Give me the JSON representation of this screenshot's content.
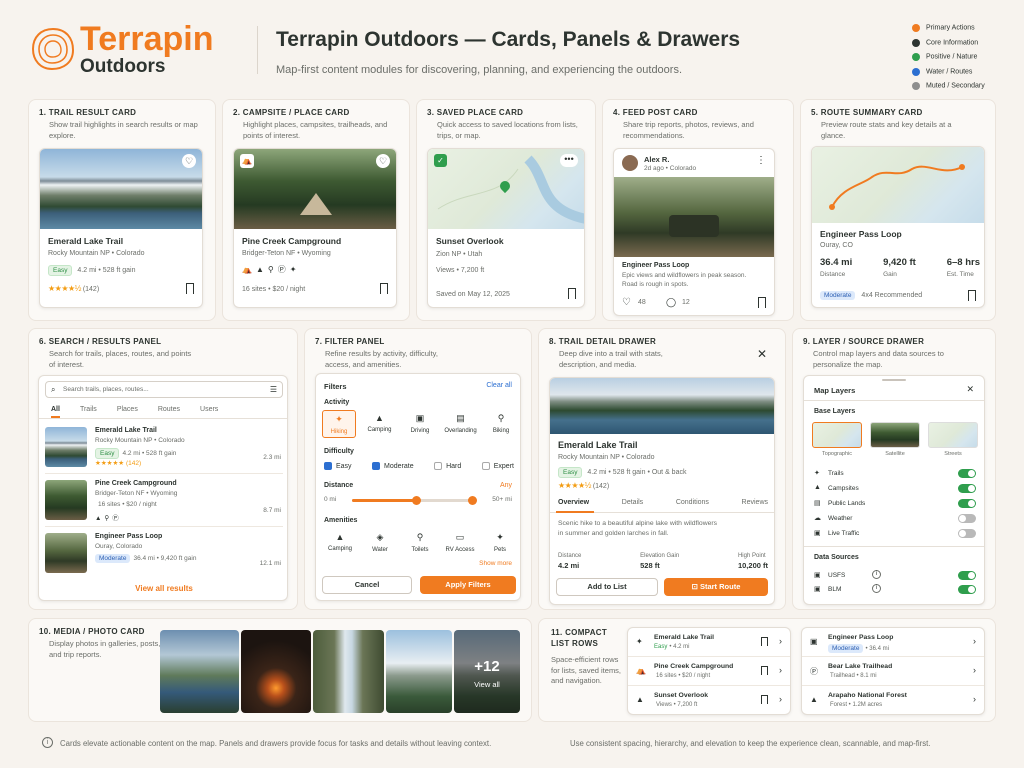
{
  "brand": {
    "name_top": "Terrapin",
    "name_bottom": "Outdoors",
    "title": "Terrapin Outdoors — Cards, Panels & Drawers",
    "subtitle": "Map-first content modules for discovering, planning, and experiencing the outdoors."
  },
  "legend": [
    {
      "label": "Primary Actions",
      "color": "#f07b20"
    },
    {
      "label": "Core Information",
      "color": "#2d3430"
    },
    {
      "label": "Positive / Nature",
      "color": "#2f9e4d"
    },
    {
      "label": "Water / Routes",
      "color": "#2c6fd1"
    },
    {
      "label": "Muted / Secondary",
      "color": "#8e8e8e"
    }
  ],
  "s1": {
    "title": "1. TRAIL RESULT CARD",
    "desc": "Show trail highlights in search results or map explore.",
    "name": "Emerald Lake Trail",
    "loc": "Rocky Mountain NP • Colorado",
    "tag": "Easy",
    "stats": "4.2 mi • 528 ft gain",
    "stars": "★★★★½",
    "reviews": "(142)"
  },
  "s2": {
    "title": "2. CAMPSITE / PLACE CARD",
    "desc": "Highlight places, campsites, trailheads, and points of interest.",
    "name": "Pine Creek Campground",
    "loc": "Bridger-Teton NF • Wyoming",
    "meta": "16 sites • $20 / night"
  },
  "s3": {
    "title": "3. SAVED PLACE CARD",
    "desc": "Quick access to saved locations from lists, trips, or map.",
    "name": "Sunset Overlook",
    "loc": "Zion NP • Utah",
    "views": "Views • 7,200 ft",
    "saved": "Saved on May 12, 2025"
  },
  "s4": {
    "title": "4. FEED POST CARD",
    "desc": "Share trip reports, photos, reviews, and recommendations.",
    "user": "Alex R.",
    "time": "2d ago • Colorado",
    "post_title": "Engineer Pass Loop",
    "post_body": "Epic views and wildflowers in peak season. Road is rough in spots.",
    "likes": "48",
    "comments": "12"
  },
  "s5": {
    "title": "5. ROUTE SUMMARY CARD",
    "desc": "Preview route stats and key details at a glance.",
    "name": "Engineer Pass Loop",
    "loc": "Ouray, CO",
    "stats": [
      {
        "v": "36.4 mi",
        "l": "Distance"
      },
      {
        "v": "9,420 ft",
        "l": "Gain"
      },
      {
        "v": "6–8 hrs",
        "l": "Est. Time"
      }
    ],
    "tag": "Moderate",
    "rec": "4x4 Recommended"
  },
  "s6": {
    "title": "6. SEARCH / RESULTS PANEL",
    "desc": "Search for trails, places, routes, and points of interest.",
    "placeholder": "Search trails, places, routes...",
    "tabs": [
      "All",
      "Trails",
      "Places",
      "Routes",
      "Users"
    ],
    "rows": [
      {
        "name": "Emerald Lake Trail",
        "loc": "Rocky Mountain NP • Colorado",
        "tag": "Easy",
        "stats": "4.2 mi • 528 ft gain",
        "extra": "★★★★★ (142)",
        "dist": "2.3 mi"
      },
      {
        "name": "Pine Creek Campground",
        "loc": "Bridger-Teton NF • Wyoming",
        "tag": "",
        "stats": "16 sites • $20 / night",
        "extra": "",
        "dist": "8.7 mi"
      },
      {
        "name": "Engineer Pass Loop",
        "loc": "Ouray, Colorado",
        "tag": "Moderate",
        "stats": "36.4 mi • 9,420 ft gain",
        "extra": "",
        "dist": "12.1 mi"
      }
    ],
    "view_all": "View all results"
  },
  "s7": {
    "title": "7. FILTER PANEL",
    "desc": "Refine results by activity, difficulty, access, and amenities.",
    "header": "Filters",
    "clear": "Clear all",
    "activity_label": "Activity",
    "activities": [
      "Hiking",
      "Camping",
      "Driving",
      "Overlanding",
      "Biking"
    ],
    "difficulty_label": "Difficulty",
    "difficulties": [
      {
        "l": "Easy",
        "on": true
      },
      {
        "l": "Moderate",
        "on": true
      },
      {
        "l": "Hard",
        "on": false
      },
      {
        "l": "Expert",
        "on": false
      }
    ],
    "distance_label": "Distance",
    "distance_any": "Any",
    "dist_min": "0 mi",
    "dist_max": "50+ mi",
    "amenities_label": "Amenities",
    "amenities": [
      "Camping",
      "Water",
      "Toilets",
      "RV Access",
      "Pets"
    ],
    "show_more": "Show more",
    "cancel": "Cancel",
    "apply": "Apply Filters"
  },
  "s8": {
    "title": "8. TRAIL DETAIL DRAWER",
    "desc": "Deep dive into a trail with stats, description, and media.",
    "name": "Emerald Lake Trail",
    "loc": "Rocky Mountain NP • Colorado",
    "tag": "Easy",
    "stats": "4.2 mi • 528 ft gain • Out & back",
    "stars": "★★★★½",
    "reviews": "(142)",
    "tabs": [
      "Overview",
      "Details",
      "Conditions",
      "Reviews"
    ],
    "body": "Scenic hike to a beautiful alpine lake with wildflowers in summer and golden larches in fall.",
    "facts": [
      {
        "l": "Distance",
        "v": "4.2 mi"
      },
      {
        "l": "Elevation Gain",
        "v": "528 ft"
      },
      {
        "l": "High Point",
        "v": "10,200 ft"
      }
    ],
    "add": "Add to List",
    "start": "Start Route"
  },
  "s9": {
    "title": "9. LAYER / SOURCE DRAWER",
    "desc": "Control map layers and data sources to personalize the map.",
    "header": "Map Layers",
    "base_label": "Base Layers",
    "bases": [
      "Topographic",
      "Satellite",
      "Streets"
    ],
    "layers": [
      {
        "l": "Trails",
        "on": true
      },
      {
        "l": "Campsites",
        "on": true
      },
      {
        "l": "Public Lands",
        "on": true
      },
      {
        "l": "Weather",
        "on": false
      },
      {
        "l": "Live Traffic",
        "on": false
      }
    ],
    "sources_label": "Data Sources",
    "sources": [
      {
        "l": "USFS",
        "on": true
      },
      {
        "l": "BLM",
        "on": true
      }
    ]
  },
  "s10": {
    "title": "10. MEDIA / PHOTO CARD",
    "desc": "Display photos in galleries, posts, and trip reports.",
    "more": "+12",
    "view_all": "View all"
  },
  "s11": {
    "title": "11. COMPACT LIST ROWS",
    "desc": "Space-efficient rows for lists, saved items, and navigation.",
    "left": [
      {
        "n": "Emerald Lake Trail",
        "tag": "Easy",
        "m": "• 4.2 mi"
      },
      {
        "n": "Pine Creek Campground",
        "tag": "",
        "m": "16 sites • $20 / night"
      },
      {
        "n": "Sunset Overlook",
        "tag": "",
        "m": "Views • 7,200 ft"
      }
    ],
    "right": [
      {
        "n": "Engineer Pass Loop",
        "tag": "Moderate",
        "m": "• 36.4 mi"
      },
      {
        "n": "Bear Lake Trailhead",
        "tag": "",
        "m": "Trailhead • 8.1 mi"
      },
      {
        "n": "Arapaho National Forest",
        "tag": "",
        "m": "Forest • 1.2M acres"
      }
    ]
  },
  "footer": {
    "left": "Cards elevate actionable content on the map. Panels and drawers provide focus for tasks and details without leaving context.",
    "right": "Use consistent spacing, hierarchy, and elevation to keep the experience clean, scannable, and map-first."
  }
}
